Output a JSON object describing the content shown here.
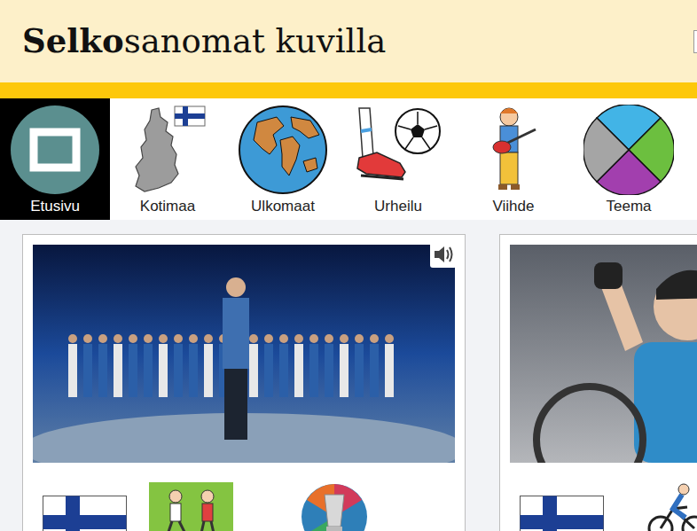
{
  "header": {
    "title_bold": "Selko",
    "title_rest": "sanomat kuvilla"
  },
  "nav": [
    {
      "label": "Etusivu",
      "selected": true,
      "kind": "home"
    },
    {
      "label": "Kotimaa",
      "selected": false,
      "kind": "finland"
    },
    {
      "label": "Ulkomaat",
      "selected": false,
      "kind": "globe"
    },
    {
      "label": "Urheilu",
      "selected": false,
      "kind": "football"
    },
    {
      "label": "Viihde",
      "selected": false,
      "kind": "music"
    },
    {
      "label": "Teema",
      "selected": false,
      "kind": "theme"
    }
  ],
  "cards": [
    {
      "photo": {
        "kind": "stage"
      },
      "audio": true,
      "symbols": [
        {
          "kind": "flag"
        },
        {
          "kind": "play"
        },
        {
          "kind": "trophy"
        }
      ]
    },
    {
      "photo": {
        "kind": "race"
      },
      "audio": false,
      "symbols": [
        {
          "kind": "flag"
        },
        {
          "kind": "cyclist"
        }
      ]
    }
  ]
}
